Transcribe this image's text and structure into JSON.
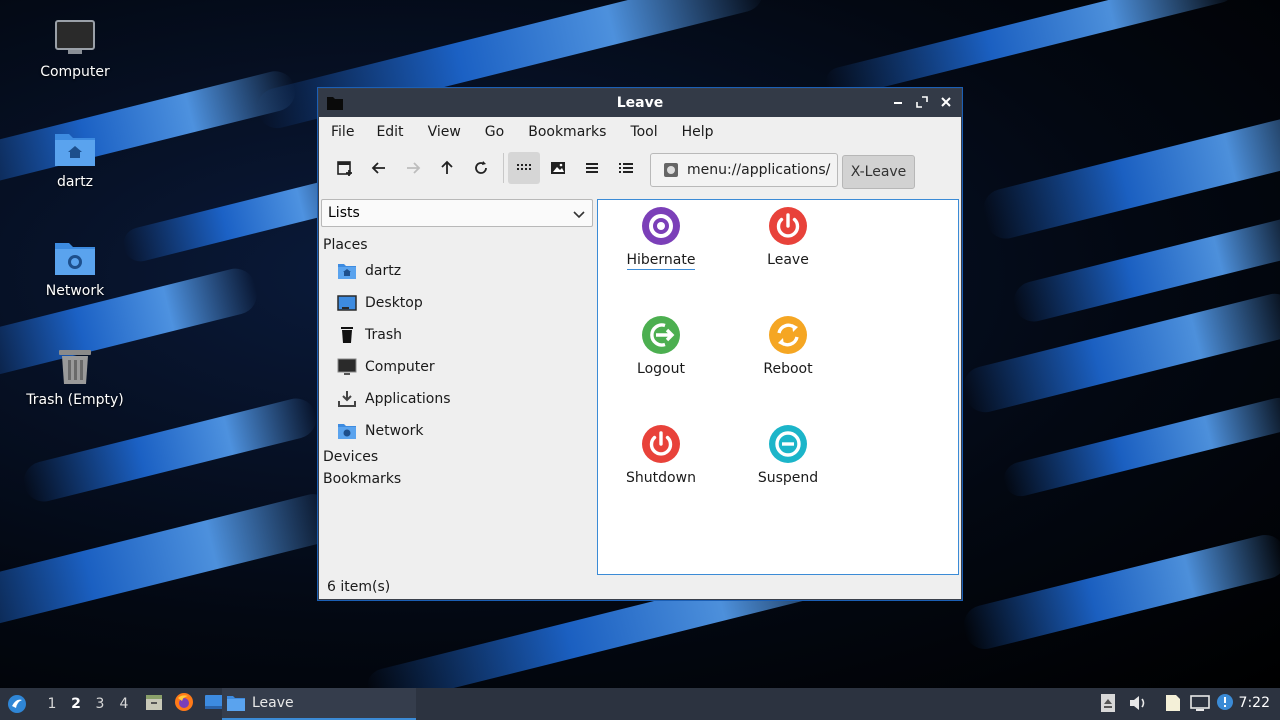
{
  "desktop": {
    "icons": [
      {
        "label": "Computer"
      },
      {
        "label": "dartz"
      },
      {
        "label": "Network"
      },
      {
        "label": "Trash (Empty)"
      }
    ]
  },
  "window": {
    "title": "Leave",
    "menu": [
      "File",
      "Edit",
      "View",
      "Go",
      "Bookmarks",
      "Tool",
      "Help"
    ],
    "path": "menu://applications/",
    "path_button": "X-Leave",
    "side": {
      "selector": "Lists",
      "places_heading": "Places",
      "places": [
        {
          "label": "dartz",
          "icon": "home-folder-icon"
        },
        {
          "label": "Desktop",
          "icon": "desktop-icon"
        },
        {
          "label": "Trash",
          "icon": "trash-icon"
        },
        {
          "label": "Computer",
          "icon": "computer-icon"
        },
        {
          "label": "Applications",
          "icon": "applications-icon"
        },
        {
          "label": "Network",
          "icon": "network-folder-icon"
        }
      ],
      "devices_heading": "Devices",
      "bookmarks_heading": "Bookmarks"
    },
    "apps": [
      {
        "label": "Hibernate",
        "color": "#7b3fb8"
      },
      {
        "label": "Leave",
        "color": "#e8423a"
      },
      {
        "label": "Logout",
        "color": "#4caf50"
      },
      {
        "label": "Reboot",
        "color": "#f5a623"
      },
      {
        "label": "Shutdown",
        "color": "#e8423a"
      },
      {
        "label": "Suspend",
        "color": "#1cb5c9"
      }
    ],
    "status": "6 item(s)"
  },
  "taskbar": {
    "workspaces": [
      "1",
      "2",
      "3",
      "4"
    ],
    "current_workspace": "2",
    "task_label": "Leave",
    "clock": "7:22"
  },
  "colors": {
    "accent": "#3b8bd6",
    "titlebar": "#333a47",
    "taskbar": "#2c3340"
  }
}
